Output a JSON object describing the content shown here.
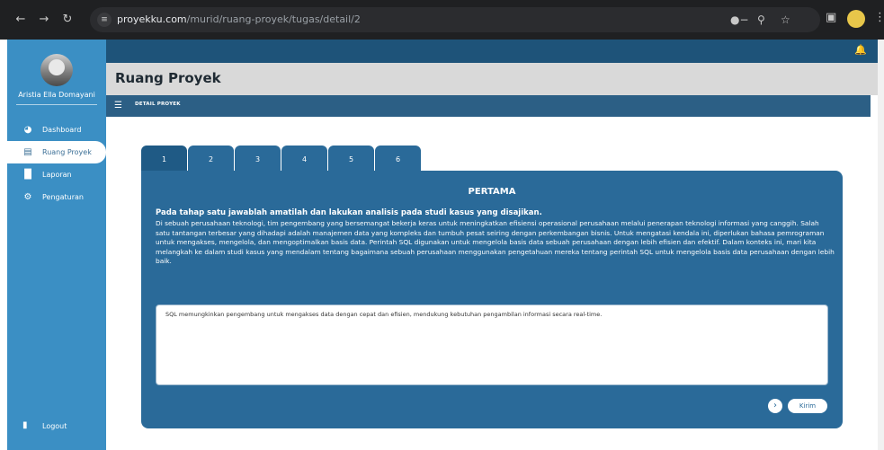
{
  "browser": {
    "url_host": "proyekku.com",
    "url_path": "/murid/ruang-proyek/tugas/detail/2"
  },
  "sidebar": {
    "user_name": "Aristia Ella Domayani",
    "items": [
      {
        "label": "Dashboard",
        "icon": "gauge-icon"
      },
      {
        "label": "Ruang Proyek",
        "icon": "document-icon"
      },
      {
        "label": "Laporan",
        "icon": "chart-icon"
      },
      {
        "label": "Pengaturan",
        "icon": "gear-icon"
      }
    ],
    "logout_label": "Logout"
  },
  "header": {
    "title": "Ruang Proyek",
    "section_label": "DETAIL PROYEK"
  },
  "tabs": [
    "1",
    "2",
    "3",
    "4",
    "5",
    "6"
  ],
  "panel": {
    "title": "PERTAMA",
    "question": "Pada tahap satu jawablah amatilah dan lakukan analisis pada studi kasus yang disajikan.",
    "case_text": "Di sebuah perusahaan teknologi, tim pengembang yang bersemangat bekerja keras untuk meningkatkan efisiensi operasional perusahaan melalui penerapan teknologi informasi yang canggih. Salah satu tantangan terbesar yang dihadapi adalah manajemen data yang kompleks dan tumbuh pesat seiring dengan perkembangan bisnis. Untuk mengatasi kendala ini, diperlukan bahasa pemrograman untuk mengakses, mengelola, dan mengoptimalkan basis data. Perintah SQL digunakan untuk mengelola basis data sebuah perusahaan dengan lebih efisien dan efektif. Dalam konteks ini, mari kita melangkah ke dalam studi kasus yang mendalam tentang bagaimana sebuah perusahaan menggunakan pengetahuan mereka tentang perintah SQL untuk mengelola basis data perusahaan dengan lebih baik.",
    "answer_value": "SQL memungkinkan pengembang untuk mengakses data dengan cepat dan efisien, mendukung kebutuhan pengambilan informasi secara real-time.",
    "submit_label": "Kirim"
  }
}
